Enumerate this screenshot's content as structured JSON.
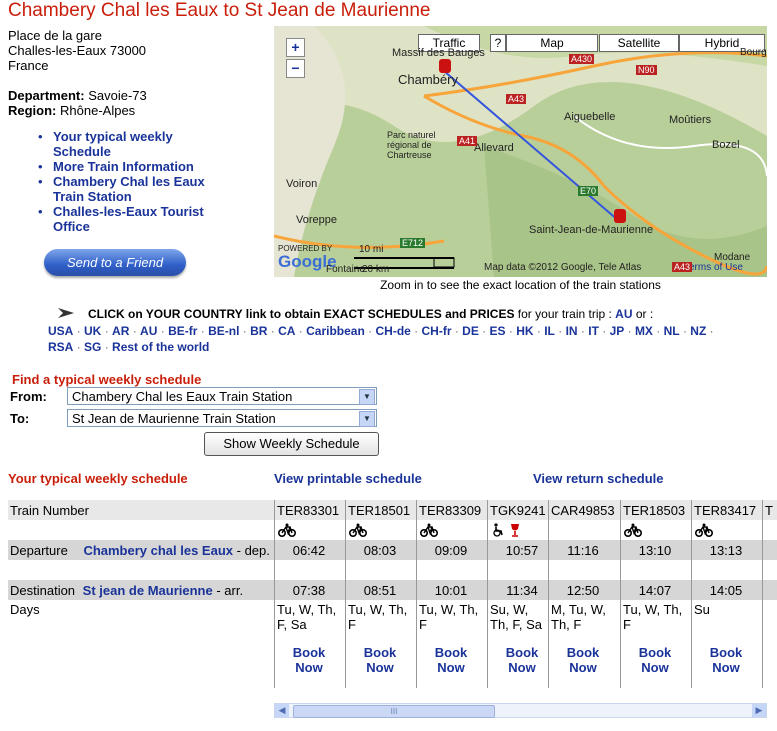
{
  "page_title": "Chambery Chal les Eaux to St Jean de Maurienne",
  "address": {
    "line1": "Place de la gare",
    "line2": "Challes-les-Eaux 73000",
    "line3": "France",
    "department_label": "Department:",
    "department_value": "Savoie-73",
    "region_label": "Region:",
    "region_value": "Rhône-Alpes"
  },
  "links": [
    "Your typical weekly Schedule",
    "More Train Information",
    "Chambery Chal les Eaux Train Station",
    "Challes-les-Eaux Tourist Office"
  ],
  "send_button": "Send to a Friend",
  "map": {
    "buttons": [
      "Traffic",
      "?",
      "Map",
      "Satellite",
      "Hybrid"
    ],
    "zoom_in": "+",
    "zoom_out": "−",
    "labels": {
      "massif": "Massif des Bauges",
      "chambery": "Chambéry",
      "aiguebelle": "Aiguebelle",
      "moutiers": "Moûtiers",
      "bozel": "Bozel",
      "chartreuse": "Parc naturel\nrégional de\nChartreuse",
      "allevard": "Allevard",
      "voiron": "Voiron",
      "voreppe": "Voreppe",
      "sjdm": "Saint-Jean-de-Maurienne",
      "scale_mi": "10 mi",
      "scale_km": "20 km",
      "copyright": "Map data ©2012 Google, Tele Atlas",
      "terms": "Terms of Use",
      "google": "Google",
      "bourg": "Bourg-Sa",
      "modane": "Modane",
      "fontaine": "Fontaine",
      "powered": "POWERED BY"
    },
    "roads": [
      "A430",
      "N90",
      "A43",
      "A41",
      "E70",
      "E712",
      "A43"
    ],
    "caption": "Zoom in to see the exact location of the train stations"
  },
  "country": {
    "intro": "CLICK on YOUR COUNTRY link to obtain EXACT SCHEDULES and PRICES",
    "intro_rest": " for your train trip : ",
    "current": "AU",
    "or": " or :",
    "links": [
      "USA",
      "UK",
      "AR",
      "AU",
      "BE-fr",
      "BE-nl",
      "BR",
      "CA",
      "Caribbean",
      "CH-de",
      "CH-fr",
      "DE",
      "ES",
      "HK",
      "IL",
      "IN",
      "IT",
      "JP",
      "MX",
      "NL",
      "NZ",
      "RSA",
      "SG",
      "Rest of the world"
    ]
  },
  "finder": {
    "title": "Find a typical weekly schedule",
    "from_label": "From:",
    "from_value": "Chambery Chal les Eaux Train Station",
    "to_label": "To:",
    "to_value": "St Jean de Maurienne Train Station",
    "button": "Show Weekly Schedule"
  },
  "schedule": {
    "title": "Your typical weekly schedule",
    "printable": "View printable schedule",
    "return": "View return schedule",
    "row_train": "Train Number",
    "row_departure": "Departure",
    "departure_station": "Chambery chal les Eaux",
    "departure_suffix": " - dep.",
    "row_destination": "Destination",
    "destination_station": "St jean de Maurienne",
    "destination_suffix": " - arr.",
    "row_days": "Days",
    "book_line1": "Book",
    "book_line2": "Now",
    "trains": [
      {
        "number": "TER83301",
        "dep": "06:42",
        "arr": "07:38",
        "days1": "Tu, W, Th,",
        "days2": "F, Sa",
        "icons": [
          "bike-icon"
        ]
      },
      {
        "number": "TER18501",
        "dep": "08:03",
        "arr": "08:51",
        "days1": "Tu, W, Th,",
        "days2": "F",
        "icons": [
          "bike-icon"
        ]
      },
      {
        "number": "TER83309",
        "dep": "09:09",
        "arr": "10:01",
        "days1": "Tu, W, Th,",
        "days2": "F",
        "icons": [
          "bike-icon"
        ]
      },
      {
        "number": "TGK9241",
        "dep": "10:57",
        "arr": "11:34",
        "days1": "Su, W,",
        "days2": "Th, F, Sa",
        "icons": [
          "wheelchair-icon",
          "wine-glass-icon"
        ]
      },
      {
        "number": "CAR49853",
        "dep": "11:16",
        "arr": "12:50",
        "days1": "M, Tu, W,",
        "days2": "Th, F",
        "icons": []
      },
      {
        "number": "TER18503",
        "dep": "13:10",
        "arr": "14:07",
        "days1": "Tu, W, Th,",
        "days2": "F",
        "icons": [
          "bike-icon"
        ]
      },
      {
        "number": "TER83417",
        "dep": "13:13",
        "arr": "14:05",
        "days1": "Su",
        "days2": "",
        "icons": [
          "bike-icon"
        ]
      },
      {
        "number": "T",
        "dep": "",
        "arr": "",
        "days1": "",
        "days2": "",
        "icons": []
      }
    ]
  },
  "scrollbar": {
    "left": "◀",
    "right": "▶",
    "grip": "III"
  }
}
